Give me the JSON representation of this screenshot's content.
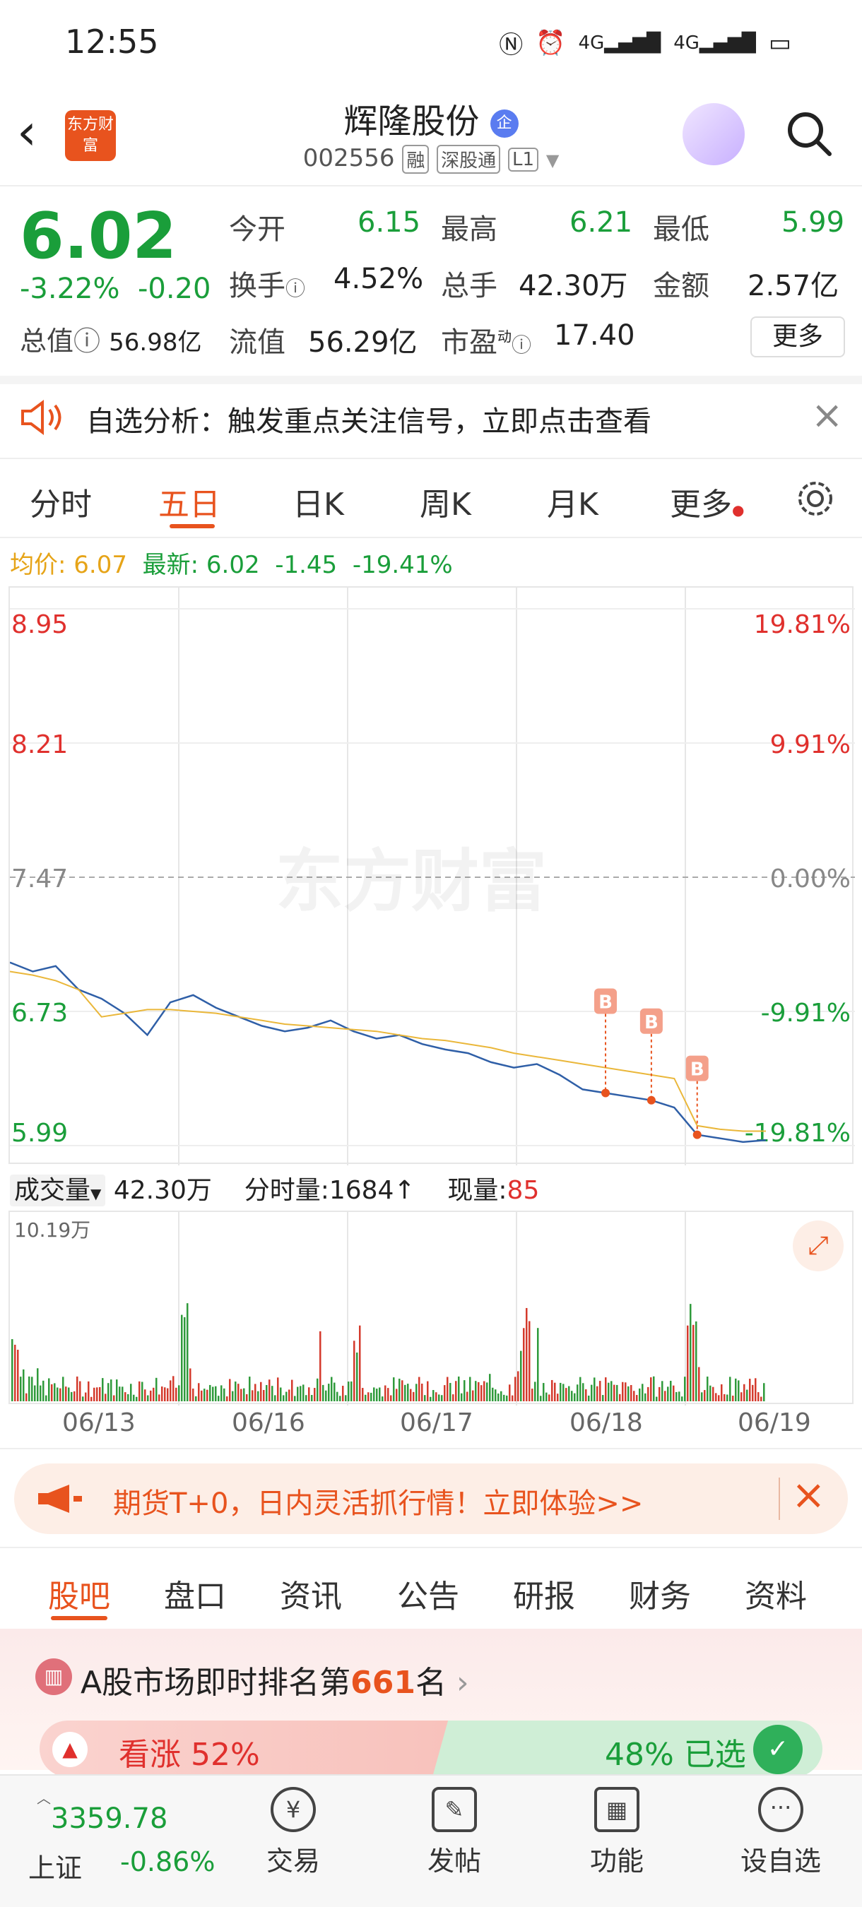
{
  "status_bar": {
    "time": "12:55",
    "icons": [
      "nfc-icon",
      "alarm-icon",
      "4g-signal-icon",
      "4g-signal-icon",
      "battery-icon"
    ]
  },
  "header": {
    "logo_text": "东方财富",
    "title": "辉隆股份",
    "title_badge": "企",
    "code": "002556",
    "tags": [
      "融",
      "深股通",
      "L1"
    ]
  },
  "quote": {
    "price": "6.02",
    "change_pct": "-3.22%",
    "change": "-0.20",
    "market_cap_label": "总值",
    "market_cap": "56.98亿",
    "open_label": "今开",
    "open": "6.15",
    "high_label": "最高",
    "high": "6.21",
    "low_label": "最低",
    "low": "5.99",
    "turnover_label": "换手",
    "turnover": "4.52%",
    "volume_label": "总手",
    "volume": "42.30万",
    "amount_label": "金额",
    "amount": "2.57亿",
    "float_cap_label": "流值",
    "float_cap": "56.29亿",
    "pe_label": "市盈",
    "pe_sup": "动",
    "pe": "17.40",
    "more_label": "更多"
  },
  "notice": {
    "text": "自选分析：触发重点关注信号，立即点击查看"
  },
  "tabs": [
    "分时",
    "五日",
    "日K",
    "周K",
    "月K",
    "更多"
  ],
  "active_tab": "五日",
  "avg_line": {
    "avg_label": "均价:",
    "avg_value": "6.07",
    "latest_label": "最新:",
    "latest_value": "6.02",
    "change": "-1.45",
    "change_pct": "-19.41%"
  },
  "chart_data": {
    "type": "line",
    "x": [
      "06/13",
      "06/16",
      "06/17",
      "06/18",
      "06/19"
    ],
    "y_ticks_left": [
      "8.95",
      "8.21",
      "7.47",
      "6.73",
      "5.99"
    ],
    "y_ticks_right": [
      "19.81%",
      "9.91%",
      "0.00%",
      "-9.91%",
      "-19.81%"
    ],
    "ylim": [
      5.99,
      8.95
    ],
    "prev_close": 7.47,
    "series": [
      {
        "values": [
          7.0,
          6.95,
          6.98,
          6.85,
          6.8,
          6.72,
          6.6,
          6.78,
          6.82,
          6.75,
          6.7,
          6.65,
          6.62,
          6.64,
          6.68,
          6.62,
          6.58,
          6.6,
          6.55,
          6.52,
          6.5,
          6.45,
          6.42,
          6.44,
          6.38,
          6.3,
          6.28,
          6.26,
          6.24,
          6.2,
          6.05,
          6.03,
          6.01,
          6.02
        ]
      },
      {
        "values": [
          6.95,
          6.93,
          6.9,
          6.85,
          6.7,
          6.72,
          6.74,
          6.74,
          6.73,
          6.72,
          6.7,
          6.68,
          6.66,
          6.65,
          6.64,
          6.63,
          6.62,
          6.6,
          6.58,
          6.57,
          6.55,
          6.53,
          6.5,
          6.48,
          6.46,
          6.44,
          6.42,
          6.4,
          6.38,
          6.36,
          6.1,
          6.08,
          6.07,
          6.07
        ]
      }
    ],
    "markers": [
      "B",
      "B",
      "B"
    ],
    "watermark": "东方财富"
  },
  "volume": {
    "label": "成交量",
    "total": "42.30万",
    "tick_label": "分时量:1684↑",
    "now_label": "现量:",
    "now_value": "85",
    "max_label": "10.19万"
  },
  "promo": {
    "text": "期货T+0，日内灵活抓行情！立即体验>>"
  },
  "section_tabs": [
    "股吧",
    "盘口",
    "资讯",
    "公告",
    "研报",
    "财务",
    "资料"
  ],
  "active_section": "股吧",
  "rank": {
    "prefix": "A股市场即时排名第",
    "num": "661",
    "suffix": "名"
  },
  "vote": {
    "up_label": "看涨 52%",
    "down_label": "48% 已选"
  },
  "bottom_nav": {
    "index_value": "3359.78",
    "index_name": "上证",
    "index_change": "-0.86%",
    "items": [
      "交易",
      "发帖",
      "功能",
      "设自选"
    ]
  }
}
